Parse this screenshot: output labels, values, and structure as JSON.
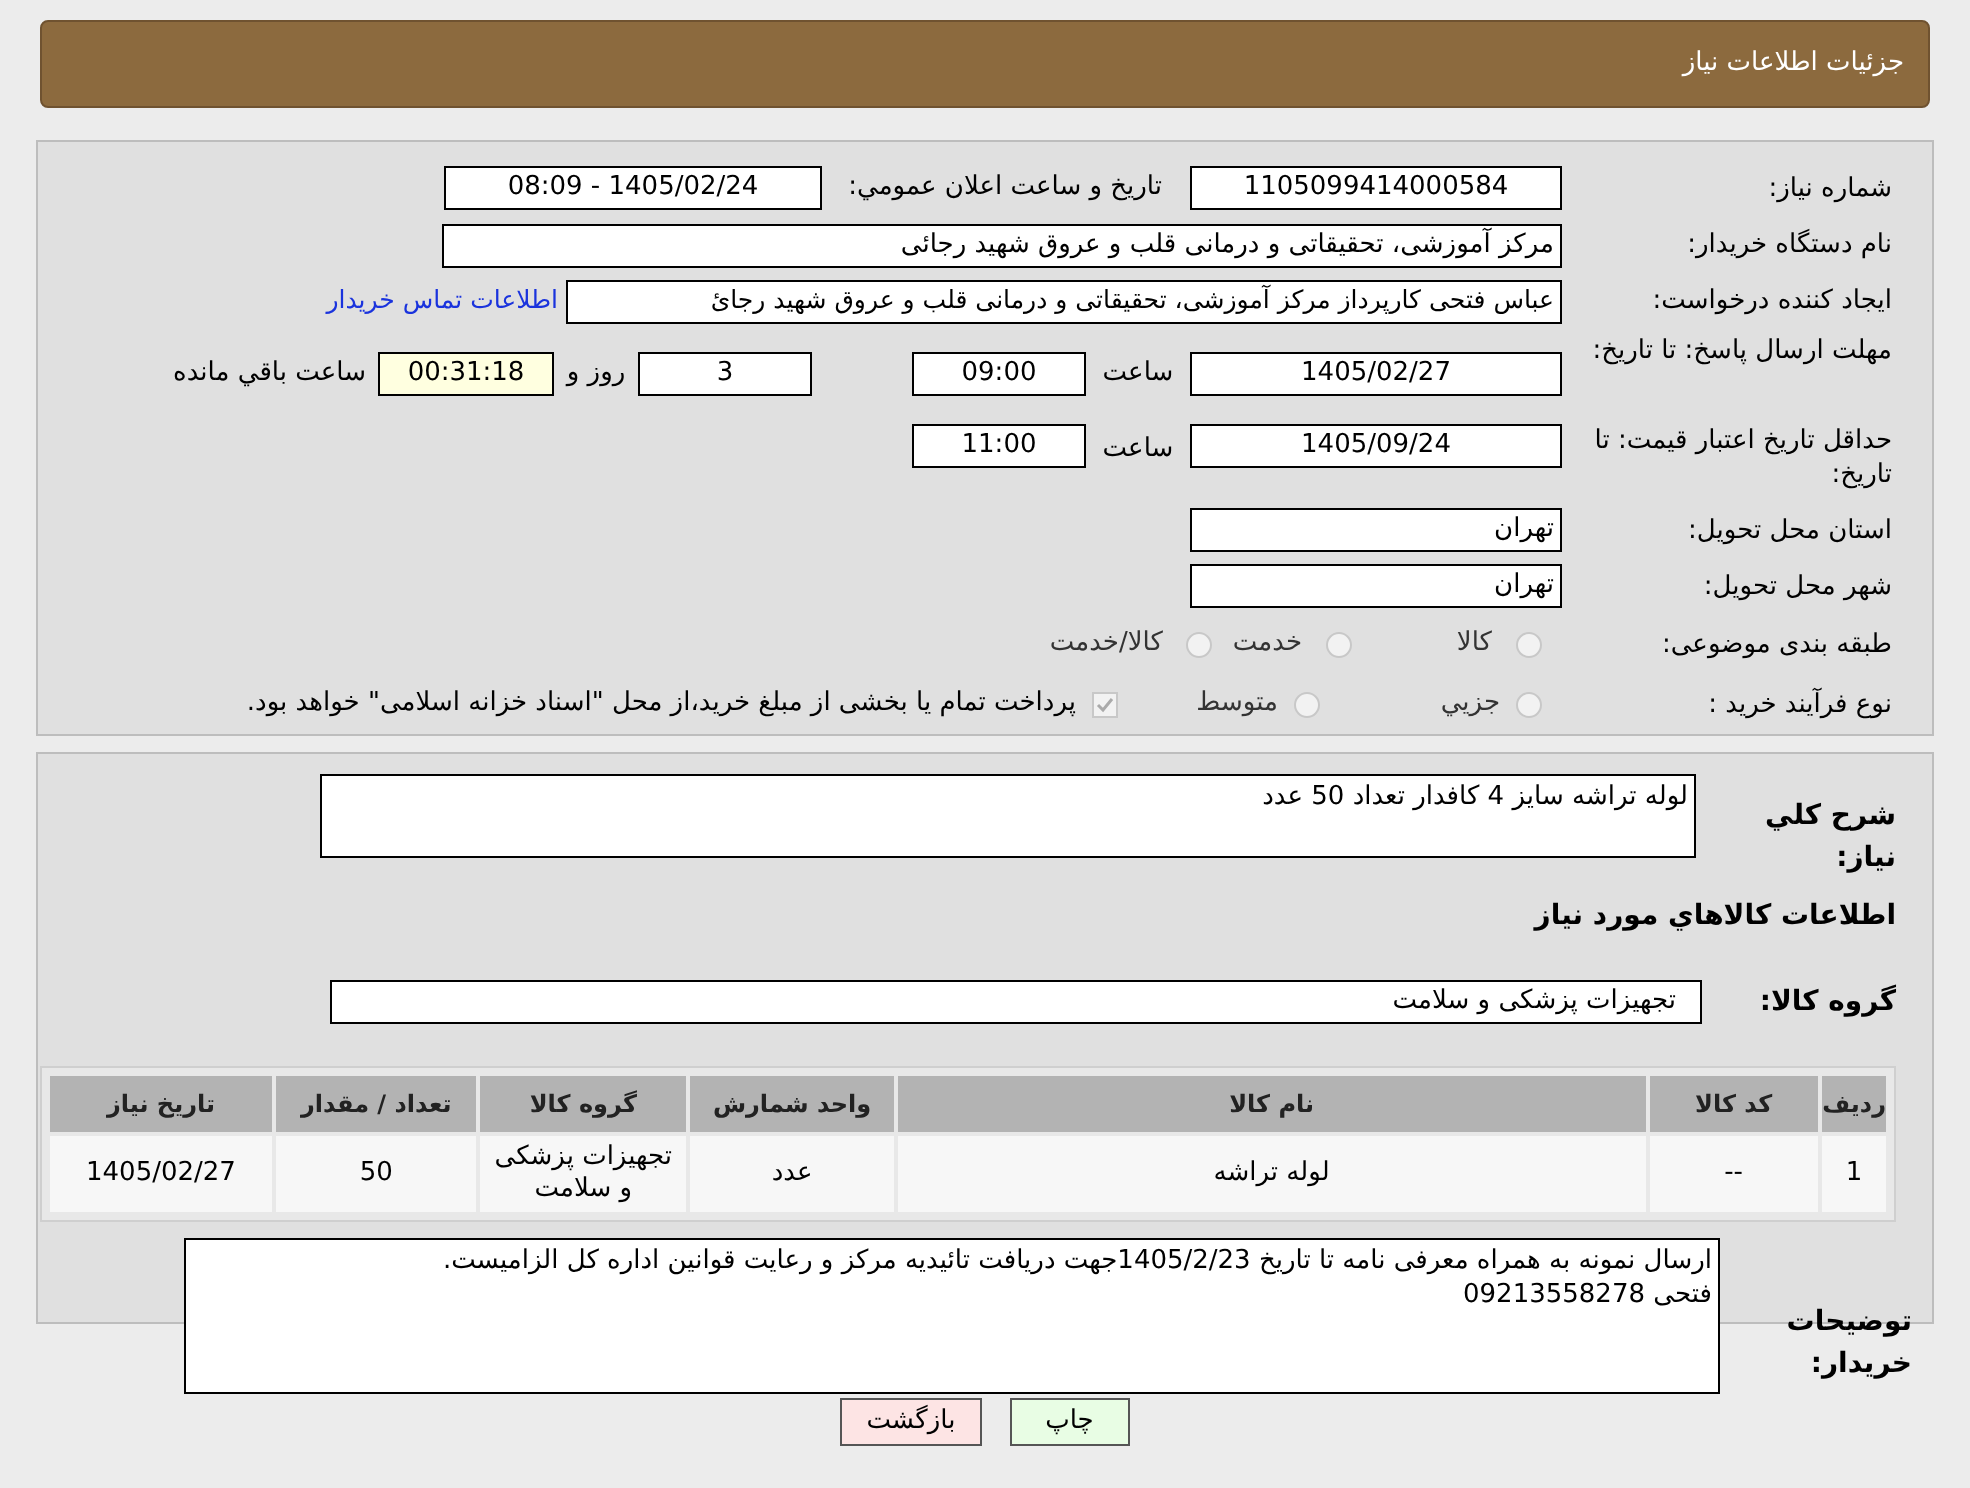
{
  "header": {
    "title": "جزئیات اطلاعات نیاز"
  },
  "details": {
    "need_number": {
      "label": "شماره نیاز:",
      "value": "1105099414000584"
    },
    "announce": {
      "label": "تاریخ و ساعت اعلان عمومي:",
      "value": "1405/02/24 - 08:09"
    },
    "buyer": {
      "label": "نام دستگاه خریدار:",
      "value": "مرکز آموزشی، تحقیقاتی و درمانی قلب و عروق شهید رجائی"
    },
    "requester": {
      "label": "ایجاد کننده درخواست:",
      "value": "عباس فتحی کارپرداز مرکز آموزشی، تحقیقاتی و درمانی قلب و عروق شهید رجائ",
      "link": "اطلاعات تماس خریدار"
    },
    "response_deadline": {
      "label": "مهلت ارسال پاسخ: تا تاریخ:",
      "date": "1405/02/27",
      "time_label": "ساعت",
      "time": "09:00",
      "days": "3",
      "days_label": "روز و",
      "remaining": "00:31:18",
      "remaining_label": "ساعت باقي مانده"
    },
    "price_validity": {
      "label": "حداقل تاریخ اعتبار قیمت: تا تاریخ:",
      "date": "1405/09/24",
      "time_label": "ساعت",
      "time": "11:00"
    },
    "province": {
      "label": "استان محل تحویل:",
      "value": "تهران"
    },
    "city": {
      "label": "شهر محل تحویل:",
      "value": "تهران"
    },
    "category": {
      "label": "طبقه بندی موضوعی:",
      "options": [
        {
          "label": "کالا",
          "selected": false
        },
        {
          "label": "خدمت",
          "selected": false
        },
        {
          "label": "کالا/خدمت",
          "selected": false
        }
      ]
    },
    "process": {
      "label": "نوع فرآیند خرید :",
      "options": [
        {
          "label": "جزیي",
          "selected": false
        },
        {
          "label": "متوسط",
          "selected": false
        }
      ],
      "checkbox": {
        "checked": true,
        "text": "پرداخت تمام یا بخشی از مبلغ خرید،از محل \"اسناد خزانه اسلامی\" خواهد بود."
      }
    }
  },
  "summary": {
    "label": "شرح کلي نیاز:",
    "value": "لوله تراشه سایز 4 کافدار تعداد 50 عدد"
  },
  "goods_heading": "اطلاعات کالاهاي مورد نیاز",
  "goods_group": {
    "label": "گروه کالا:",
    "value": "تجهیزات پزشکی و سلامت"
  },
  "table": {
    "columns": [
      "ردیف",
      "کد کالا",
      "نام کالا",
      "واحد شمارش",
      "گروه کالا",
      "تعداد / مقدار",
      "تاریخ نیاز"
    ],
    "rows": [
      [
        "1",
        "--",
        "لوله تراشه",
        "عدد",
        "تجهیزات پزشکی و سلامت",
        "50",
        "1405/02/27"
      ]
    ]
  },
  "buyer_notes": {
    "label": "توضیحات خریدار:",
    "lines": [
      "ارسال نمونه به همراه معرفی نامه تا تاریخ 1405/2/23جهت دریافت تائیدیه مرکز و رعایت قوانین اداره کل الزامیست.",
      "فتحی 09213558278"
    ]
  },
  "buttons": [
    {
      "kind": "print",
      "label": "چاپ"
    },
    {
      "kind": "back",
      "label": "بازگشت"
    }
  ]
}
